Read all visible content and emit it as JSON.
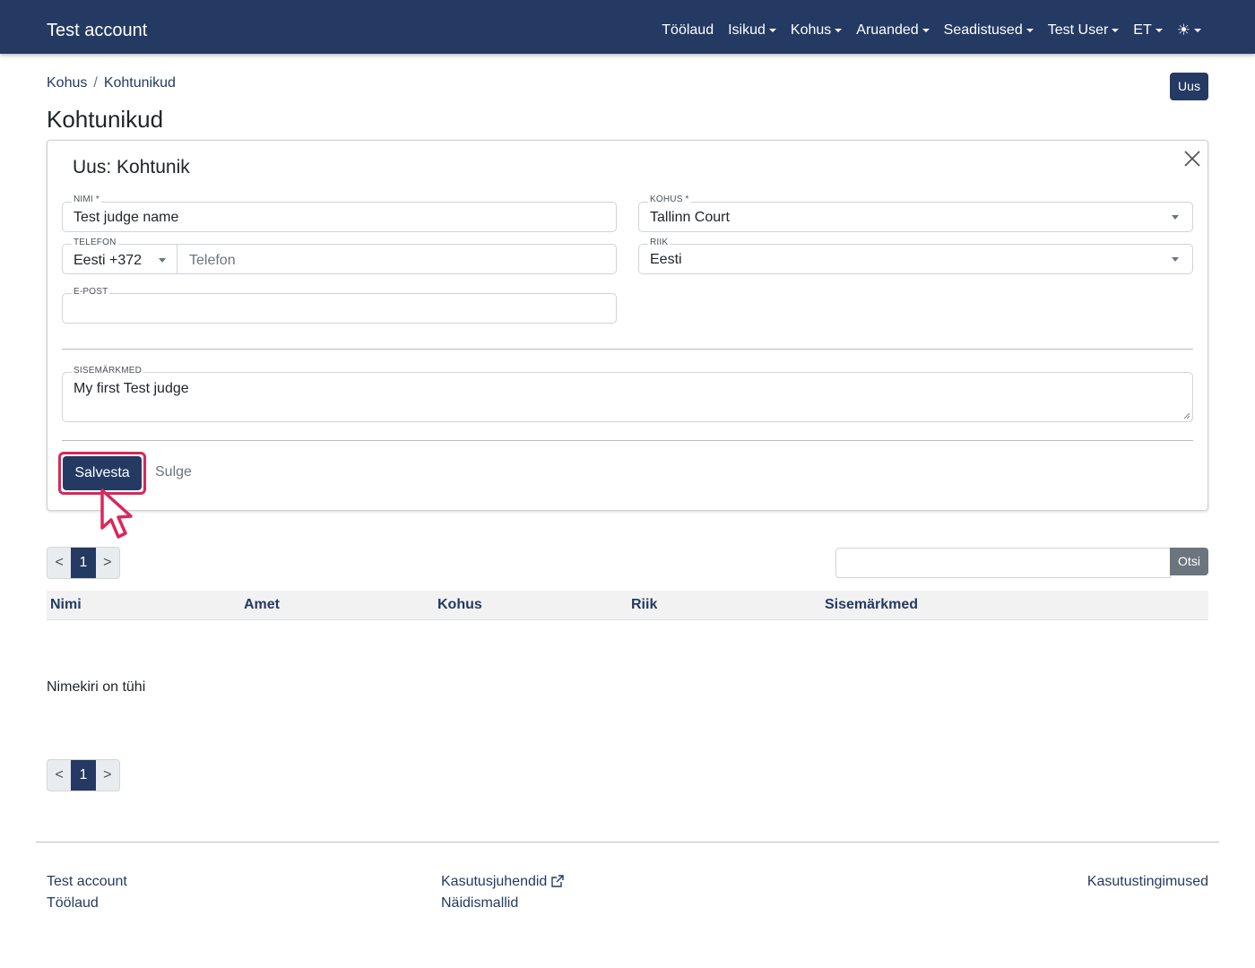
{
  "navbar": {
    "brand": "Test account",
    "items": [
      {
        "label": "Töölaud",
        "dropdown": false
      },
      {
        "label": "Isikud",
        "dropdown": true
      },
      {
        "label": "Kohus",
        "dropdown": true
      },
      {
        "label": "Aruanded",
        "dropdown": true
      },
      {
        "label": "Seadistused",
        "dropdown": true
      },
      {
        "label": "Test User",
        "dropdown": true
      },
      {
        "label": "ET",
        "dropdown": true
      }
    ],
    "theme_icon": "☀",
    "theme_icon_name": "sun-icon"
  },
  "breadcrumb": [
    "Kohus",
    "Kohtunikud"
  ],
  "breadcrumb_separator": "/",
  "new_button": "Uus",
  "page_title": "Kohtunikud",
  "form": {
    "title": "Uus: Kohtunik",
    "name": {
      "label": "NIMI *",
      "value": "Test judge name"
    },
    "court": {
      "label": "KOHUS *",
      "value": "Tallinn Court"
    },
    "phone": {
      "label": "TELEFON",
      "prefix": "Eesti +372",
      "placeholder": "Telefon"
    },
    "country": {
      "label": "RIIK",
      "value": "Eesti"
    },
    "email": {
      "label": "E-POST",
      "value": ""
    },
    "notes": {
      "label": "SISEMÄRKMED",
      "value": "My first Test judge"
    },
    "save_button": "Salvesta",
    "close_button": "Sulge"
  },
  "pagination": {
    "prev": "<",
    "current": "1",
    "next": ">"
  },
  "search_button": "Otsi",
  "table": {
    "columns": [
      "Nimi",
      "Amet",
      "Kohus",
      "Riik",
      "Sisemärkmed"
    ],
    "empty_text": "Nimekiri on tühi"
  },
  "footer": {
    "col1": [
      "Test account",
      "Töölaud"
    ],
    "col2": [
      "Kasutusjuhendid",
      "Näidismallid"
    ],
    "col3": [
      "Kasutustingimused"
    ]
  },
  "colors": {
    "primary": "#243a63",
    "highlight": "#d8285a",
    "secondary": "#6c757d"
  }
}
